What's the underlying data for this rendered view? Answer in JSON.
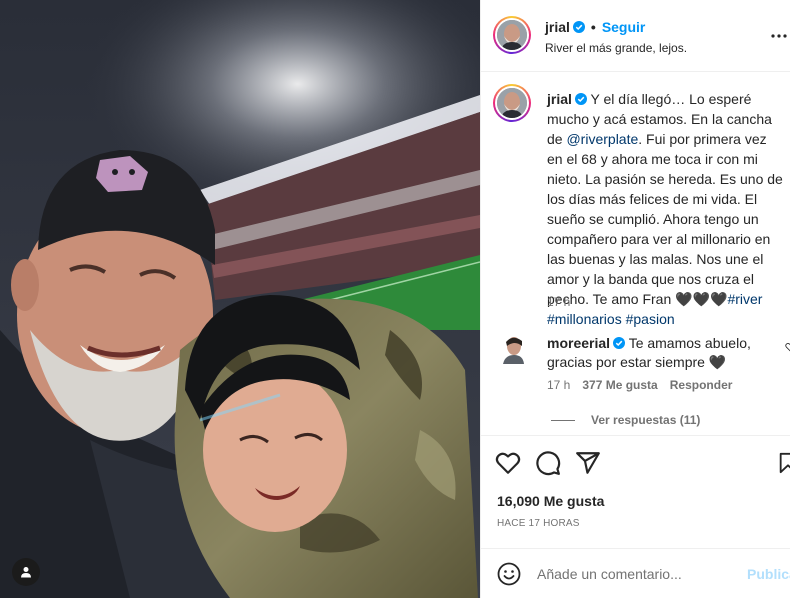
{
  "post": {
    "username": "jrial",
    "follow_label": "Seguir",
    "location": "River el más grande, lejos.",
    "caption_before_mention": "Y el día llegó… Lo esperé mucho y acá estamos. En la cancha de ",
    "caption_mention": "@riverplate",
    "caption_after_mention": ". Fui por primera vez en el 68 y ahora me toca ir con mi nieto. La pasión se hereda. Es uno de los días más felices de mi vida. El sueño se cumplió. Ahora tengo un compañero para ver al millonario en las buenas y las malas. Nos une el amor y la banda que nos cruza el pecho. Te amo Fran ",
    "caption_hearts": "🖤🖤🖤",
    "hashtags": [
      "#river",
      "#millonarios",
      "#pasion"
    ],
    "caption_time": "17 h",
    "likes": "16,090 Me gusta",
    "date": "HACE 17 HORAS"
  },
  "comments": [
    {
      "username": "moreerial",
      "text": "Te amamos abuelo, gracias por estar siempre 🖤",
      "time": "17 h",
      "likes": "377 Me gusta",
      "reply_label": "Responder",
      "view_replies": "Ver respuestas (11)"
    }
  ],
  "add_comment": {
    "placeholder": "Añade un comentario...",
    "post_label": "Publicar"
  },
  "icons": {
    "like": "heart-icon",
    "comment": "comment-icon",
    "share": "share-icon",
    "save": "bookmark-icon",
    "emoji": "emoji-icon",
    "more": "more-options-icon",
    "verified": "verified-badge-icon",
    "tag": "user-tag-icon"
  },
  "colors": {
    "accent": "#0095f6",
    "link": "#00376b",
    "muted": "#737373",
    "post_disabled": "#b2dffc"
  }
}
